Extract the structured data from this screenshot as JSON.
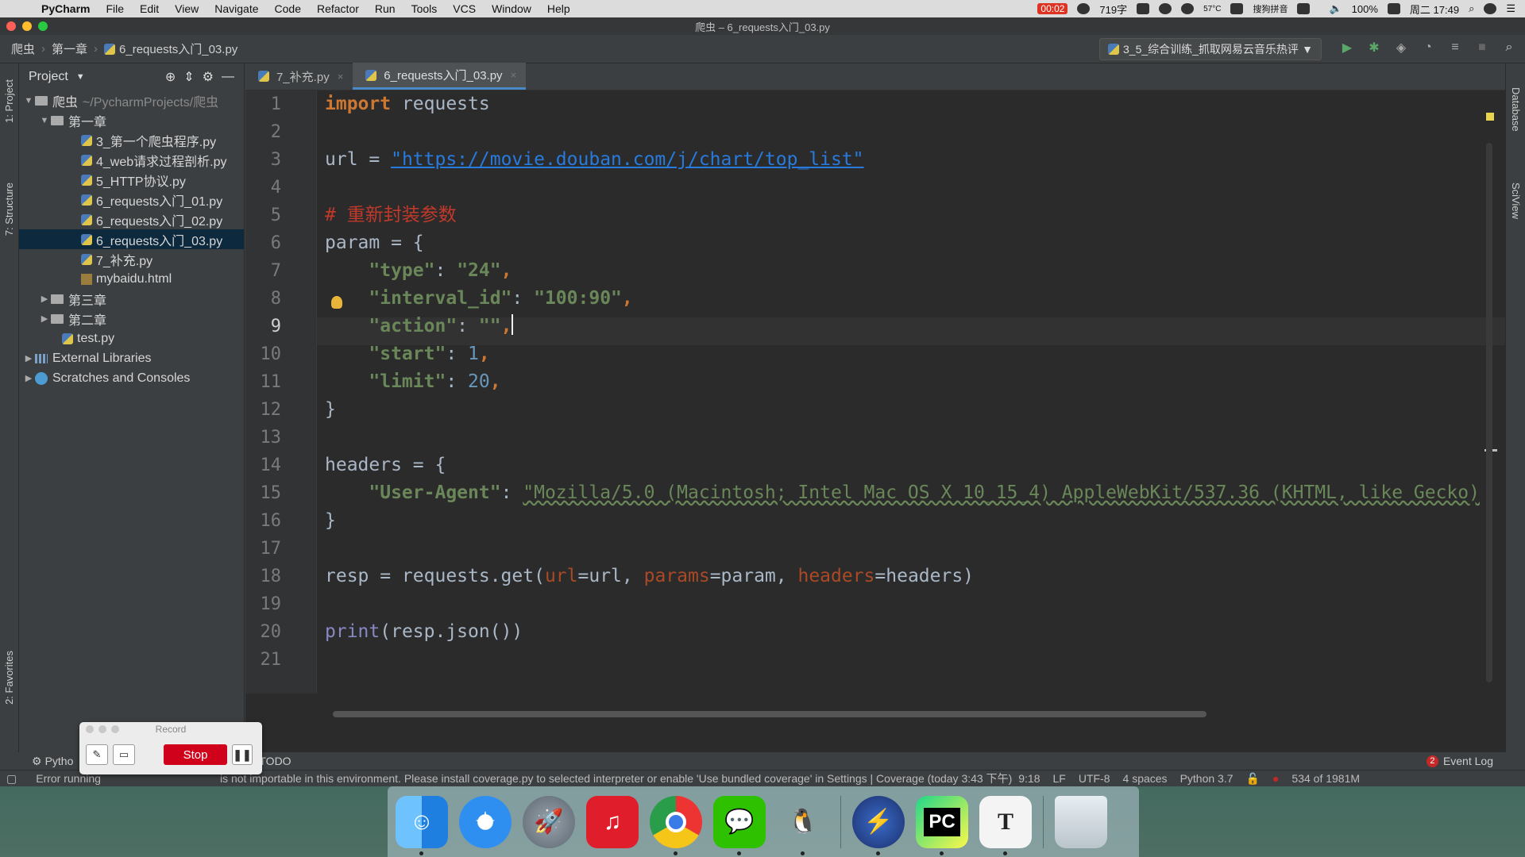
{
  "menubar": {
    "app_name": "PyCharm",
    "items": [
      "File",
      "Edit",
      "View",
      "Navigate",
      "Code",
      "Refactor",
      "Run",
      "Tools",
      "VCS",
      "Window",
      "Help"
    ],
    "record_time": "00:02",
    "word_count": "719字",
    "temp": "57°C",
    "battery": "100%",
    "datetime": "周二 17:49",
    "ime": "搜狗拼音"
  },
  "window": {
    "title": "爬虫 – 6_requests入门_03.py",
    "breadcrumb": [
      "爬虫",
      "第一章",
      "6_requests入门_03.py"
    ],
    "run_config": "3_5_综合训练_抓取网易云音乐热评"
  },
  "project": {
    "header": "Project",
    "side_tabs": {
      "project": "1: Project",
      "structure": "7: Structure",
      "favorites": "2: Favorites"
    },
    "root": {
      "name": "爬虫",
      "path": "~/PycharmProjects/爬虫"
    },
    "folder1": "第一章",
    "files": [
      "3_第一个爬虫程序.py",
      "4_web请求过程剖析.py",
      "5_HTTP协议.py",
      "6_requests入门_01.py",
      "6_requests入门_02.py",
      "6_requests入门_03.py",
      "7_补充.py",
      "mybaidu.html"
    ],
    "folder3": "第三章",
    "folder2": "第二章",
    "test_file": "test.py",
    "external_libs": "External Libraries",
    "scratches": "Scratches and Consoles"
  },
  "tabs": [
    {
      "label": "7_补充.py"
    },
    {
      "label": "6_requests入门_03.py"
    }
  ],
  "code": {
    "line_numbers": [
      "1",
      "2",
      "3",
      "4",
      "5",
      "6",
      "7",
      "8",
      "9",
      "10",
      "11",
      "12",
      "13",
      "14",
      "15",
      "16",
      "17",
      "18",
      "19",
      "20",
      "21"
    ],
    "l1_kw": "import",
    "l1_rest": " requests",
    "l3_pre": "url = ",
    "l3_url": "\"https://movie.douban.com/j/chart/top_list\"",
    "l5_comment": "# 重新封装参数",
    "l6": "param = {",
    "l7_key": "\"type\"",
    "l7_val": "\"24\"",
    "l8_key": "\"interval_id\"",
    "l8_val": "\"100:90\"",
    "l9_key": "\"action\"",
    "l9_val": "\"\"",
    "l10_key": "\"start\"",
    "l10_val": "1",
    "l11_key": "\"limit\"",
    "l11_val": "20",
    "l12": "}",
    "l14": "headers = {",
    "l15_key": "\"User-Agent\"",
    "l15_val": "\"Mozilla/5.0 (Macintosh; Intel Mac OS X 10_15_4) AppleWebKit/537.36 (KHTML, like Gecko)",
    "l16": "}",
    "l18_pre": "resp = requests.get(",
    "l18_p1": "url",
    "l18_v1": "=url, ",
    "l18_p2": "params",
    "l18_v2": "=param, ",
    "l18_p3": "headers",
    "l18_v3": "=headers)",
    "l20_fn": "print",
    "l20_rest": "(resp.json())"
  },
  "right_tabs": {
    "database": "Database",
    "sciview": "SciView"
  },
  "toolwindows": {
    "python": "Pytho",
    "todo": "TODO",
    "event_log": "Event Log",
    "event_count": "2"
  },
  "status": {
    "message_start": "Error running",
    "message": "is not importable in this environment. Please install coverage.py to selected interpreter or enable 'Use bundled coverage' in Settings | Coverage (today 3:43 下午)",
    "position": "9:18",
    "line_sep": "LF",
    "encoding": "UTF-8",
    "indent": "4 spaces",
    "interpreter": "Python 3.7",
    "memory": "534 of 1981M"
  },
  "record": {
    "title": "Record",
    "stop": "Stop"
  },
  "dock": [
    "Finder",
    "Safari",
    "Launchpad",
    "NetEase Music",
    "Chrome",
    "WeChat",
    "QQ",
    "Reeder",
    "PyCharm",
    "Typora",
    "Trash"
  ],
  "colors": {
    "accent": "#4a88c7",
    "keyword": "#cc7832",
    "string": "#6a8759",
    "number": "#6897bb",
    "stop": "#d0021b"
  }
}
